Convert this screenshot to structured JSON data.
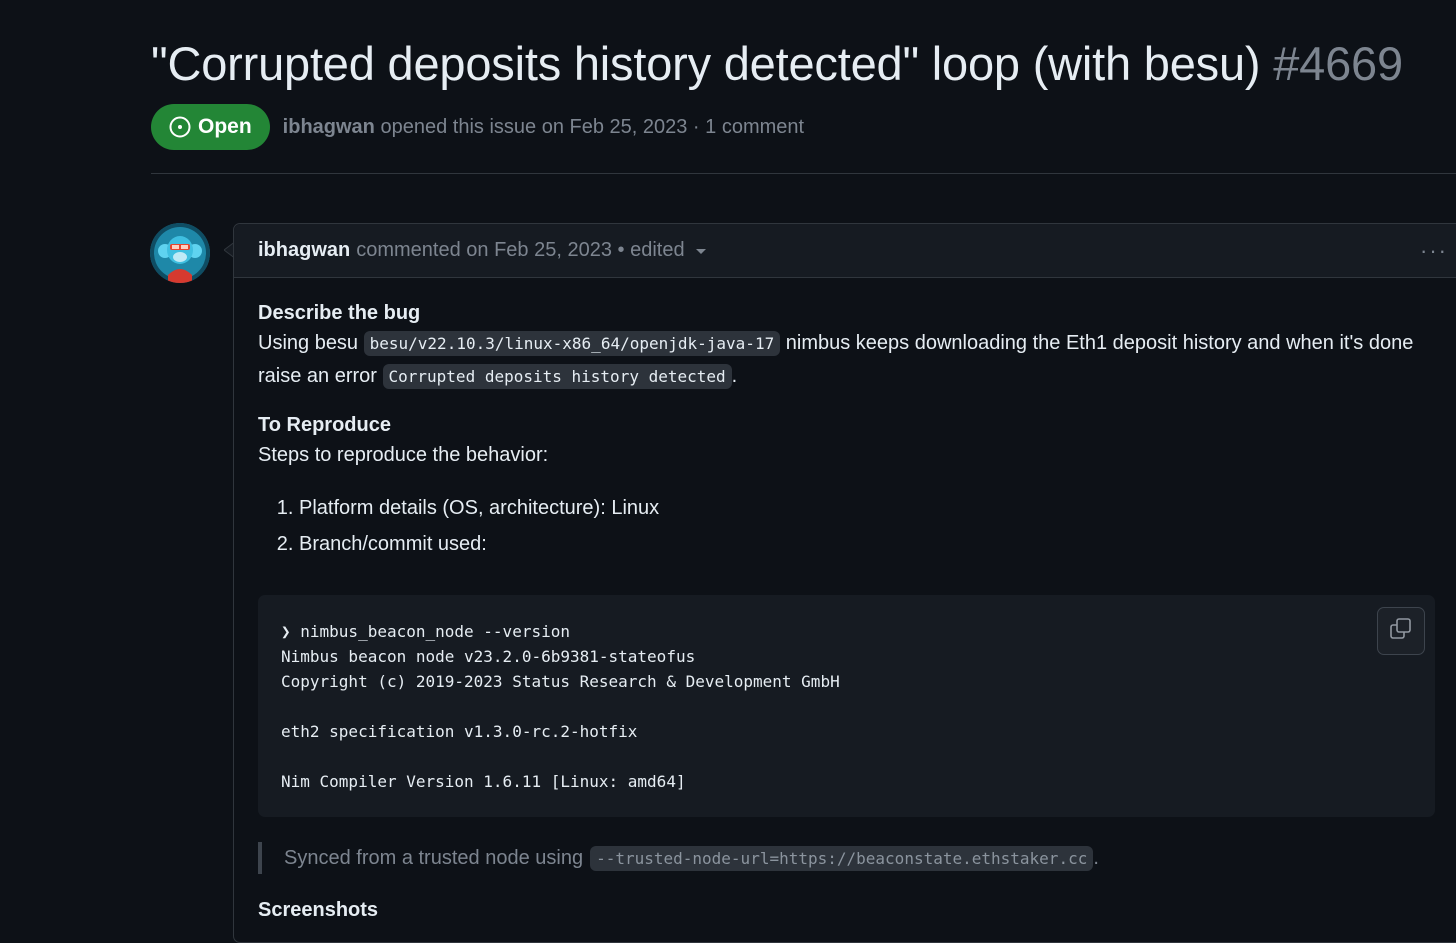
{
  "issue": {
    "title": "\"Corrupted deposits history detected\" loop (with besu)",
    "number": "#4669",
    "state": "Open",
    "author": "ibhagwan",
    "opened_text": "opened this issue on Feb 25, 2023 · 1 comment"
  },
  "comment": {
    "author": "ibhagwan",
    "meta": "commented on Feb 25, 2023 • edited",
    "more_label": "···",
    "sections": {
      "bug_heading": "Describe the bug",
      "bug_text_1": "Using besu",
      "bug_code_1": "besu/v22.10.3/linux-x86_64/openjdk-java-17",
      "bug_text_2": "nimbus keeps downloading the Eth1 deposit history and when it's done raise an error",
      "bug_code_2": "Corrupted deposits history detected",
      "bug_text_3": ".",
      "repro_heading": "To Reproduce",
      "repro_text": "Steps to reproduce the behavior:",
      "steps": [
        "Platform details (OS, architecture): Linux",
        "Branch/commit used:"
      ],
      "code_lines": [
        "❯ nimbus_beacon_node --version",
        "Nimbus beacon node v23.2.0-6b9381-stateofus",
        "Copyright (c) 2019-2023 Status Research & Development GmbH",
        "",
        "eth2 specification v1.3.0-rc.2-hotfix",
        "",
        "Nim Compiler Version 1.6.11 [Linux: amd64]"
      ],
      "quote_text": "Synced from a trusted node using",
      "quote_code": "--trusted-node-url=https://beaconstate.ethstaker.cc",
      "quote_end": ".",
      "screenshots_heading": "Screenshots"
    }
  },
  "colors": {
    "background": "#0d1117",
    "open_badge": "#238636",
    "muted": "#7d8590",
    "border": "#30363d"
  }
}
